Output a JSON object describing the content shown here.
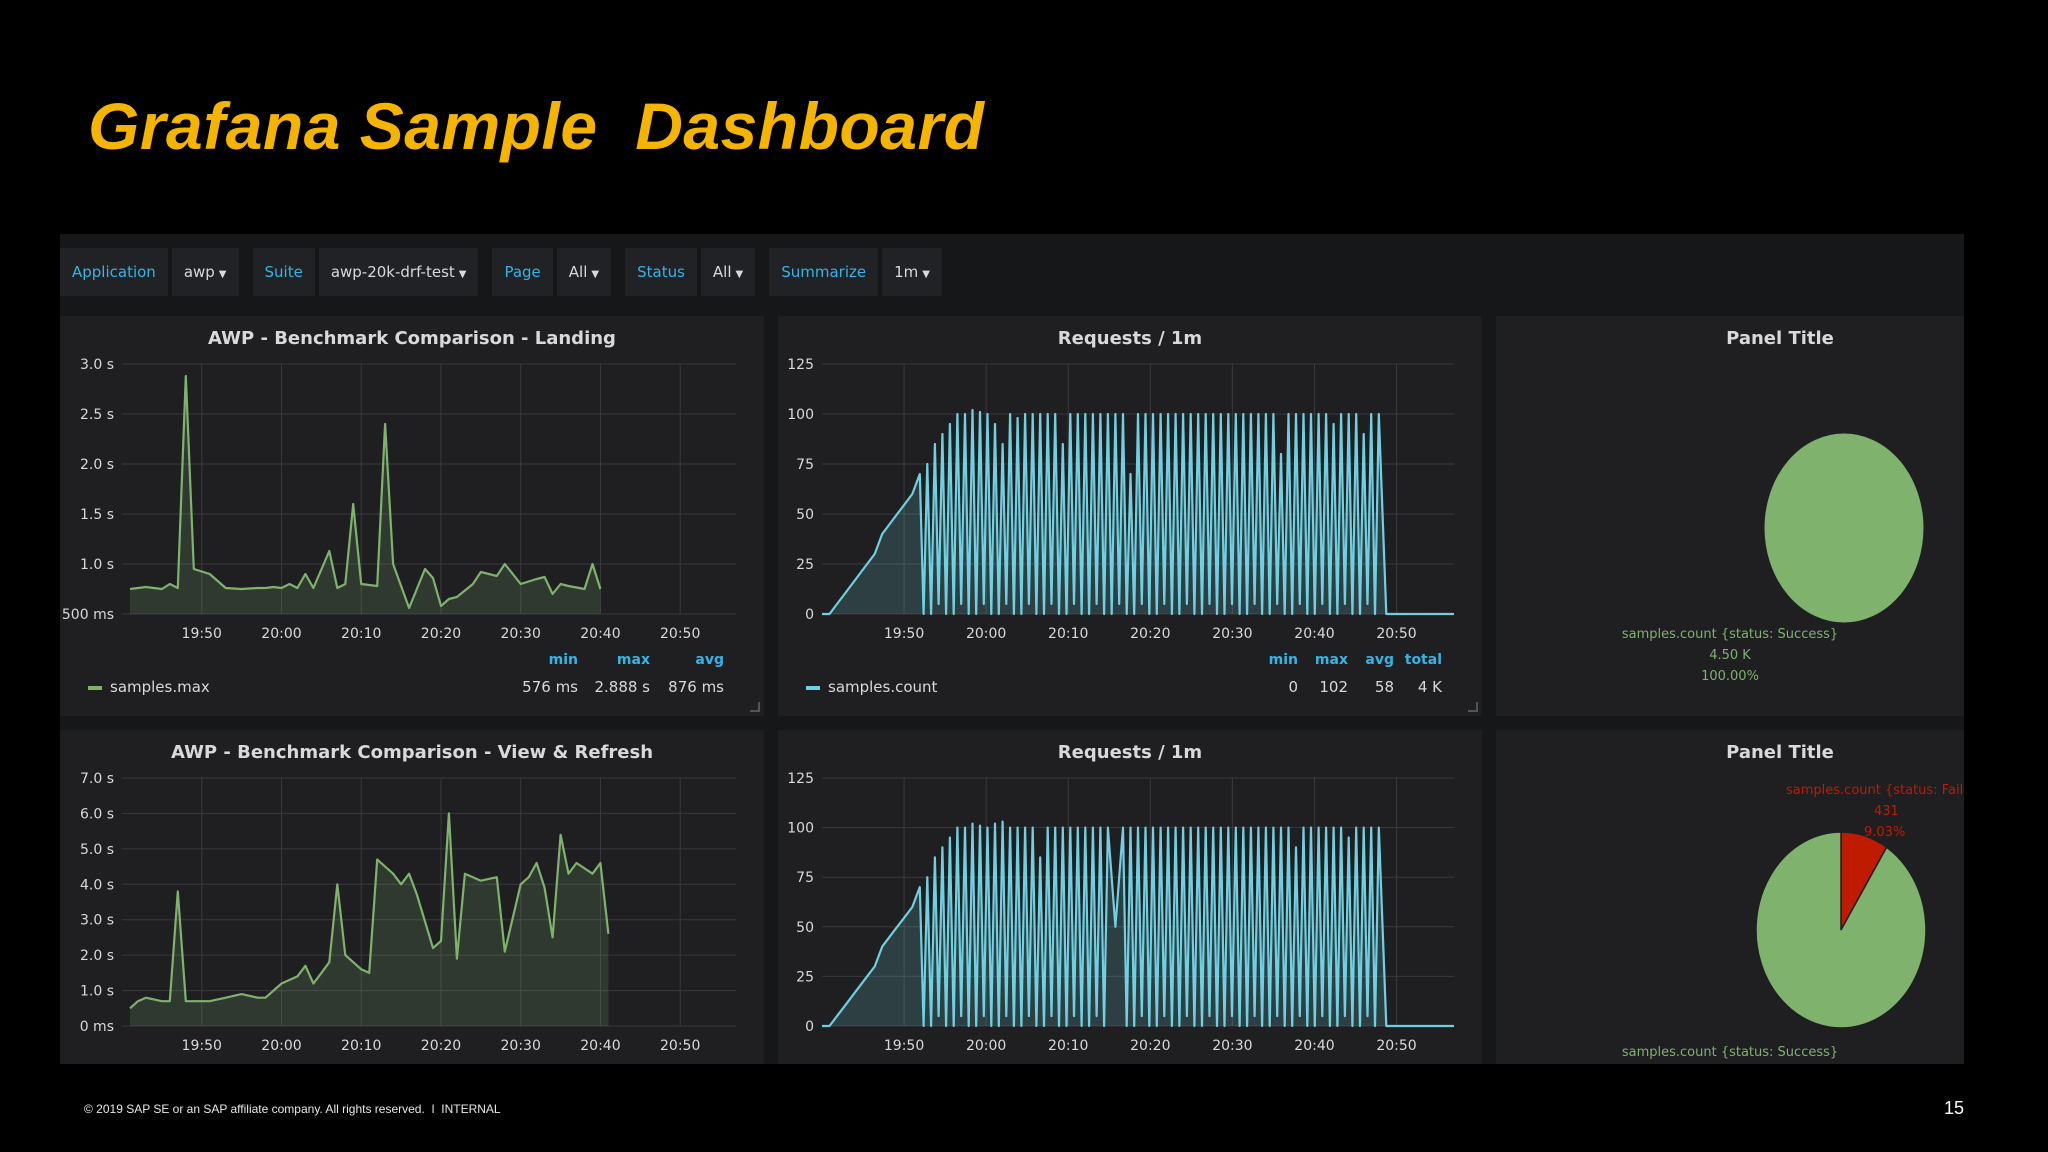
{
  "slide": {
    "title": "Grafana Sample  Dashboard",
    "footer": "© 2019 SAP SE or an SAP affiliate company. All rights reserved.  ǀ  INTERNAL",
    "page_number": "15"
  },
  "colors": {
    "title": "#f4b400",
    "latency_series": "#7eb26d",
    "requests_series": "#6ed0e0",
    "variable_label": "#33b5e5",
    "pie_success": "#7eb26d",
    "pie_failure": "#bf1b00"
  },
  "variables": [
    {
      "label": "Application",
      "value": "awp"
    },
    {
      "label": "Suite",
      "value": "awp-20k-drf-test"
    },
    {
      "label": "Page",
      "value": "All"
    },
    {
      "label": "Status",
      "value": "All"
    },
    {
      "label": "Summarize",
      "value": "1m"
    }
  ],
  "panels": {
    "landing": {
      "title": "AWP - Benchmark Comparison - Landing",
      "legend": {
        "series": "samples.max",
        "columns": [
          {
            "header": "min",
            "value": "576 ms"
          },
          {
            "header": "max",
            "value": "2.888 s"
          },
          {
            "header": "avg",
            "value": "876 ms"
          }
        ]
      }
    },
    "requests_1": {
      "title": "Requests / 1m",
      "legend": {
        "series": "samples.count",
        "columns": [
          {
            "header": "min",
            "value": "0"
          },
          {
            "header": "max",
            "value": "102"
          },
          {
            "header": "avg",
            "value": "58"
          },
          {
            "header": "total",
            "value": "4 K"
          }
        ]
      }
    },
    "pie_1": {
      "title": "Panel Title",
      "labels": [
        "samples.count {status: Success}",
        "4.50 K",
        "100.00%"
      ]
    },
    "view_refresh": {
      "title": "AWP - Benchmark Comparison - View & Refresh"
    },
    "requests_2": {
      "title": "Requests / 1m"
    },
    "pie_2": {
      "title": "Panel Title",
      "failure_labels": [
        "samples.count {status: Failure}",
        "431",
        "9.03%"
      ],
      "success_label": "samples.count {status: Success}"
    }
  },
  "chart_data": [
    {
      "id": "landing",
      "type": "area",
      "title": "AWP - Benchmark Comparison - Landing",
      "ylim": [
        500,
        3000
      ],
      "y_ticks": [
        "500 ms",
        "1.0 s",
        "1.5 s",
        "2.0 s",
        "2.5 s",
        "3.0 s"
      ],
      "x_ticks": [
        "19:50",
        "20:00",
        "20:10",
        "20:20",
        "20:30",
        "20:40",
        "20:50"
      ],
      "grid": true,
      "series": [
        {
          "name": "samples.max",
          "color": "#7eb26d",
          "x": [
            "19:41",
            "19:43",
            "19:45",
            "19:46",
            "19:47",
            "19:48",
            "19:49",
            "19:51",
            "19:53",
            "19:55",
            "19:57",
            "19:58",
            "19:59",
            "20:00",
            "20:01",
            "20:02",
            "20:03",
            "20:04",
            "20:06",
            "20:07",
            "20:08",
            "20:09",
            "20:10",
            "20:12",
            "20:13",
            "20:14",
            "20:16",
            "20:18",
            "20:19",
            "20:20",
            "20:21",
            "20:22",
            "20:24",
            "20:25",
            "20:27",
            "20:28",
            "20:30",
            "20:32",
            "20:33",
            "20:34",
            "20:35",
            "20:36",
            "20:38",
            "20:39",
            "20:40"
          ],
          "y": [
            750,
            770,
            750,
            800,
            760,
            2880,
            950,
            900,
            760,
            750,
            760,
            760,
            770,
            760,
            800,
            760,
            900,
            760,
            1130,
            760,
            800,
            1600,
            800,
            780,
            2400,
            1000,
            560,
            950,
            860,
            580,
            650,
            670,
            800,
            920,
            880,
            1000,
            800,
            850,
            870,
            700,
            800,
            780,
            750,
            1000,
            750
          ]
        }
      ]
    },
    {
      "id": "requests_1",
      "type": "line",
      "title": "Requests / 1m",
      "ylim": [
        0,
        125
      ],
      "y_ticks": [
        "0",
        "25",
        "50",
        "75",
        "100",
        "125"
      ],
      "x_ticks": [
        "19:50",
        "20:00",
        "20:10",
        "20:20",
        "20:30",
        "20:40",
        "20:50"
      ],
      "grid": true,
      "series": [
        {
          "name": "samples.count",
          "color": "#6ed0e0",
          "x_range": [
            "19:40",
            "20:57"
          ],
          "note_pattern": "ramp to ~100 req/min then oscillating 0-100 until ~20:42, then 0",
          "y": [
            0,
            0,
            5,
            10,
            15,
            20,
            25,
            30,
            40,
            45,
            50,
            55,
            60,
            70,
            75,
            85,
            90,
            95,
            100,
            100,
            102,
            101,
            100,
            95,
            85,
            100,
            98,
            100,
            100,
            100,
            100,
            100,
            85,
            100,
            100,
            100,
            100,
            100,
            100,
            100,
            100,
            70,
            100,
            100,
            100,
            100,
            100,
            100,
            100,
            100,
            100,
            100,
            100,
            100,
            100,
            100,
            100,
            100,
            100,
            100,
            100,
            80,
            100,
            100,
            100,
            100,
            100,
            100,
            95,
            100,
            100,
            100,
            90,
            100,
            100,
            0,
            0,
            0,
            0,
            0,
            0,
            0,
            0,
            0,
            0
          ]
        }
      ]
    },
    {
      "id": "pie_1",
      "type": "pie",
      "title": "Panel Title",
      "categories": [
        "samples.count {status: Success}"
      ],
      "values": [
        4500
      ],
      "colors": [
        "#7eb26d"
      ]
    },
    {
      "id": "view_refresh",
      "type": "area",
      "title": "AWP - Benchmark Comparison - View & Refresh",
      "ylim": [
        0,
        7000
      ],
      "y_ticks": [
        "0 ms",
        "1.0 s",
        "2.0 s",
        "3.0 s",
        "4.0 s",
        "5.0 s",
        "6.0 s",
        "7.0 s"
      ],
      "x_ticks": [
        "19:50",
        "20:00",
        "20:10",
        "20:20",
        "20:30",
        "20:40",
        "20:50"
      ],
      "grid": true,
      "series": [
        {
          "name": "samples.max",
          "color": "#7eb26d",
          "x": [
            "19:41",
            "19:42",
            "19:43",
            "19:45",
            "19:46",
            "19:47",
            "19:48",
            "19:49",
            "19:51",
            "19:53",
            "19:55",
            "19:57",
            "19:58",
            "20:00",
            "20:02",
            "20:03",
            "20:04",
            "20:05",
            "20:06",
            "20:07",
            "20:08",
            "20:10",
            "20:11",
            "20:12",
            "20:13",
            "20:14",
            "20:15",
            "20:16",
            "20:17",
            "20:19",
            "20:20",
            "20:21",
            "20:22",
            "20:23",
            "20:25",
            "20:27",
            "20:28",
            "20:30",
            "20:31",
            "20:32",
            "20:33",
            "20:34",
            "20:35",
            "20:36",
            "20:37",
            "20:39",
            "20:40",
            "20:41"
          ],
          "y": [
            500,
            700,
            800,
            700,
            700,
            3800,
            700,
            700,
            700,
            800,
            900,
            800,
            800,
            1200,
            1400,
            1700,
            1200,
            1500,
            1800,
            4000,
            2000,
            1600,
            1500,
            4700,
            4500,
            4300,
            4000,
            4300,
            3700,
            2200,
            2400,
            6000,
            1900,
            4300,
            4100,
            4200,
            2100,
            4000,
            4200,
            4600,
            3900,
            2500,
            5400,
            4300,
            4600,
            4300,
            4600,
            2600
          ]
        }
      ]
    },
    {
      "id": "requests_2",
      "type": "line",
      "title": "Requests / 1m",
      "ylim": [
        0,
        125
      ],
      "y_ticks": [
        "0",
        "25",
        "50",
        "75",
        "100",
        "125"
      ],
      "x_ticks": [
        "19:50",
        "20:00",
        "20:10",
        "20:20",
        "20:30",
        "20:40",
        "20:50"
      ],
      "grid": true,
      "series": [
        {
          "name": "samples.count",
          "color": "#6ed0e0",
          "x_range": [
            "19:40",
            "20:57"
          ],
          "y": [
            0,
            0,
            5,
            10,
            15,
            20,
            25,
            30,
            40,
            45,
            50,
            55,
            60,
            70,
            75,
            85,
            90,
            95,
            100,
            100,
            102,
            101,
            100,
            102,
            103,
            100,
            100,
            100,
            100,
            85,
            100,
            100,
            100,
            100,
            100,
            100,
            100,
            100,
            100,
            50,
            100,
            100,
            100,
            100,
            100,
            100,
            100,
            100,
            100,
            100,
            100,
            100,
            100,
            100,
            100,
            100,
            100,
            100,
            100,
            100,
            100,
            100,
            100,
            90,
            100,
            100,
            100,
            100,
            100,
            100,
            95,
            100,
            100,
            100,
            100,
            0,
            0,
            0,
            0,
            0,
            0,
            0,
            0,
            0,
            0
          ]
        }
      ]
    },
    {
      "id": "pie_2",
      "type": "pie",
      "title": "Panel Title",
      "categories": [
        "samples.count {status: Success}",
        "samples.count {status: Failure}"
      ],
      "values": [
        4346,
        431
      ],
      "colors": [
        "#7eb26d",
        "#bf1b00"
      ]
    }
  ]
}
